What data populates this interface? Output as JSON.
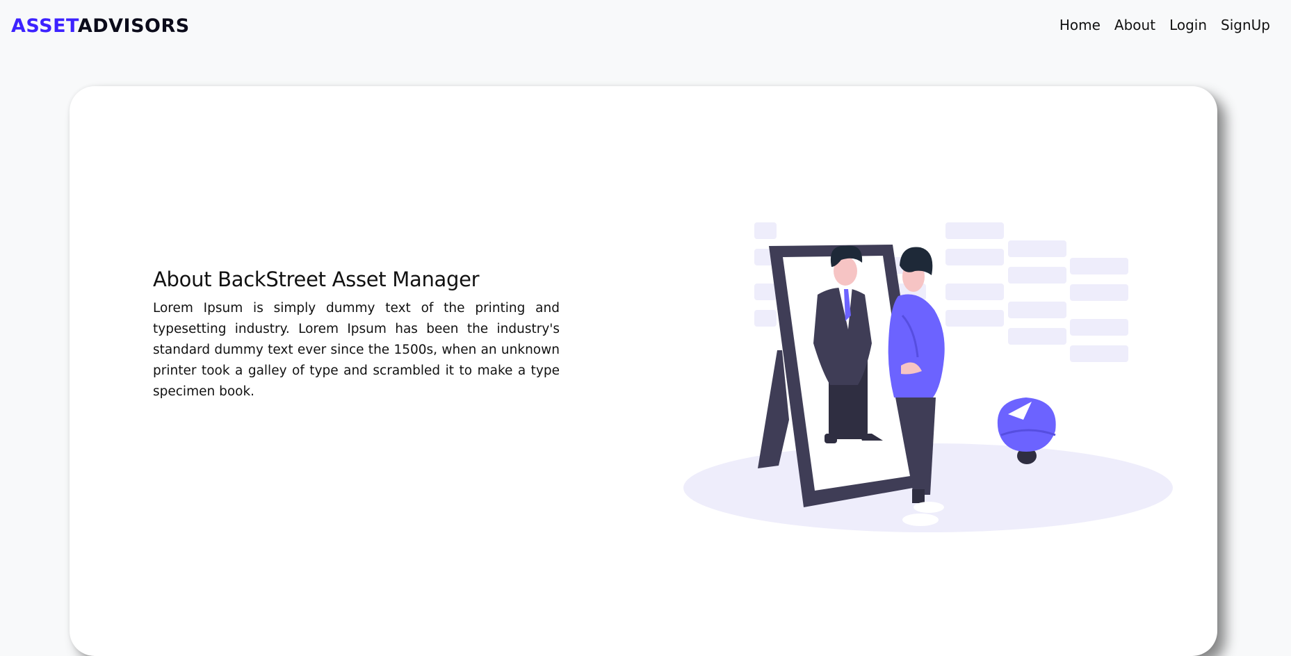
{
  "brand": {
    "part_a": "ASSET",
    "part_b": "ADVISORS",
    "accent_color": "#3d22ff",
    "dark_color": "#0b0b1a"
  },
  "nav": {
    "items": [
      {
        "label": "Home"
      },
      {
        "label": "About"
      },
      {
        "label": "Login"
      },
      {
        "label": "SignUp"
      }
    ]
  },
  "about": {
    "title": "About BackStreet Asset Manager",
    "body": "Lorem Ipsum is simply dummy text of the printing and typesetting industry. Lorem Ipsum has been the industry's standard dummy text ever since the 1500s, when an unknown printer took a galley of type and scrambled it to make a type specimen book."
  },
  "illustration": {
    "icon": "person-at-mirror-illustration",
    "accent_color": "#6c63ff",
    "frame_color": "#3f3d56"
  }
}
